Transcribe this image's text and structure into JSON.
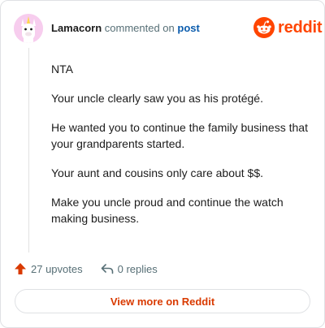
{
  "header": {
    "author": "Lamacorn",
    "commented_text": "commented on",
    "post_link": "post",
    "logo_text": "reddit",
    "brand_color": "#ff4500"
  },
  "comment": {
    "paragraphs": [
      "NTA",
      "Your uncle clearly saw you as his protégé.",
      "He wanted you to continue the family business that your grandparents started.",
      "Your aunt and cousins only care about $$.",
      "Make you uncle proud and continue the watch making business."
    ]
  },
  "actions": {
    "upvotes": "27 upvotes",
    "replies": "0 replies",
    "upvote_icon": "upvote-arrow-icon",
    "reply_icon": "reply-arrow-icon"
  },
  "footer": {
    "view_more_label": "View more on Reddit"
  }
}
